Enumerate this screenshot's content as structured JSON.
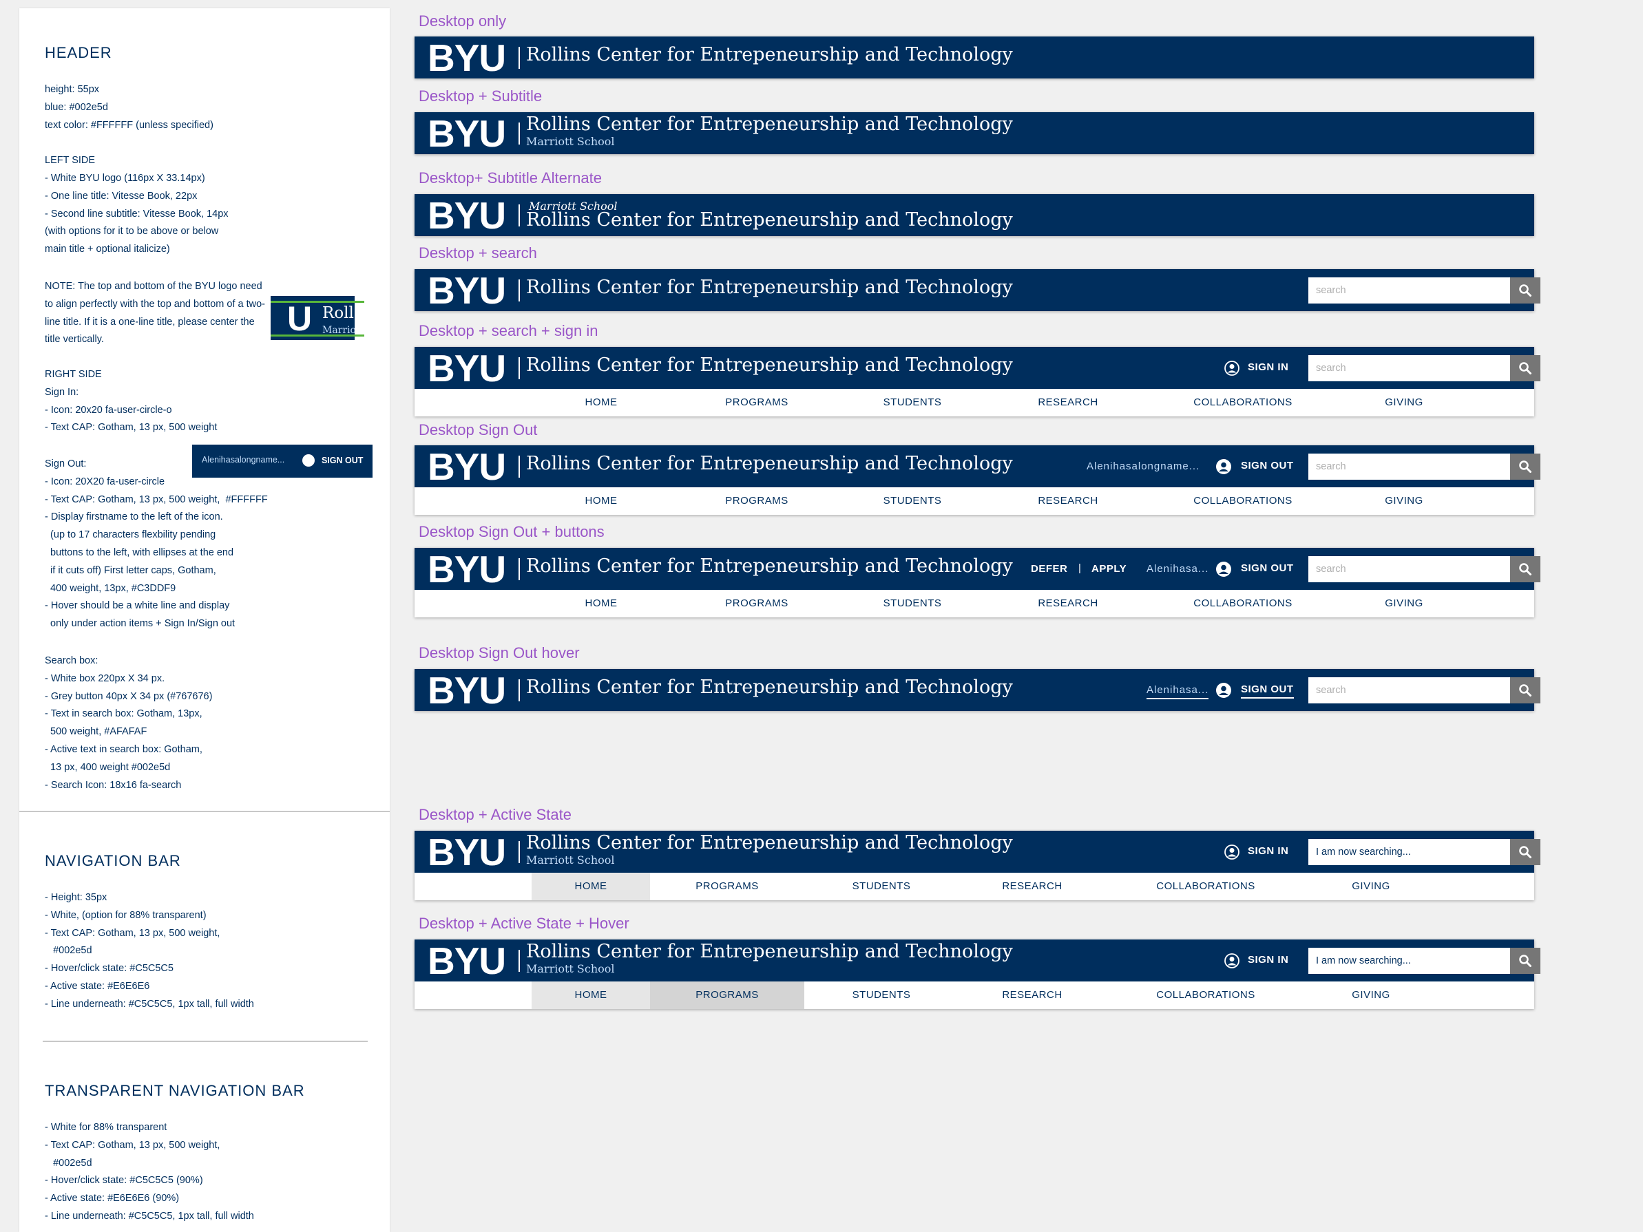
{
  "panel": {
    "header_title": "HEADER",
    "header_spec": "height: 55px\nblue: #002e5d\ntext color: #FFFFFF (unless specified)\n\nLEFT SIDE\n- White BYU logo (116px X 33.14px)\n- One line title: Vitesse Book, 22px\n- Second line subtitle: Vitesse Book, 14px\n(with options for it to be above or below\nmain title + optional italicize)",
    "note": "NOTE: The top and bottom of the BYU logo need to align perfectly with the top and bottom of a two-line title. If it is a one-line title, please center the title vertically.",
    "right_spec": "RIGHT SIDE\nSign In:\n- Icon: 20x20 fa-user-circle-o\n- Text CAP: Gotham, 13 px, 500 weight",
    "signout_spec": "Sign Out:\n- Icon: 20X20 fa-user-circle\n- Text CAP: Gotham, 13 px, 500 weight,  #FFFFFF\n- Display firstname to the left of the icon.\n  (up to 17 characters flexbility pending\n  buttons to the left, with ellipses at the end\n  if it cuts off) First letter caps, Gotham,\n  400 weight, 13px, #C3DDF9\n- Hover should be a white line and display\n  only under action items + Sign In/Sign out",
    "search_spec": "Search box:\n- White box 220px X 34 px.\n- Grey button 40px X 34 px (#767676)\n- Text in search box: Gotham, 13px,\n  500 weight, #AFAFAF\n- Active text in search box: Gotham,\n  13 px, 400 weight #002e5d\n- Search Icon: 18x16 fa-search",
    "nav_title": "NAVIGATION BAR",
    "nav_spec": "- Height: 35px\n- White, (option for 88% transparent)\n- Text CAP: Gotham, 13 px, 500 weight,\n   #002e5d\n- Hover/click state: #C5C5C5\n- Active state: #E6E6E6\n- Line underneath: #C5C5C5, 1px tall, full width",
    "tnav_title": "TRANSPARENT NAVIGATION BAR",
    "tnav_spec": "- White for 88% transparent\n- Text CAP: Gotham, 13 px, 500 weight,\n   #002e5d\n- Hover/click state: #C5C5C5 (90%)\n- Active state: #E6E6E6 (90%)\n- Line underneath: #C5C5C5, 1px tall, full width",
    "logo_sample": {
      "letter": "U",
      "title_fragment": "Roll",
      "subtitle_fragment": "Marrio"
    },
    "signout_sample": {
      "name": "Alenihasalongname...",
      "label": "SIGN OUT"
    }
  },
  "brand": {
    "logo": "BYU",
    "blue": "#002e5d",
    "name_color": "#C3DDF9",
    "search_button": "#767676",
    "label_color": "#9a56c8"
  },
  "common": {
    "title": "Rollins Center for Entrepeneurship and Technology",
    "subtitle": "Marriott School",
    "search_placeholder": "search",
    "search_active": "I am now searching...",
    "sign_in": "SIGN IN",
    "sign_out": "SIGN OUT",
    "name_long": "Alenihasalongname...",
    "name_short": "Alenihasa...",
    "defer": "DEFER",
    "pipe": "|",
    "apply": "APPLY"
  },
  "nav": [
    "HOME",
    "PROGRAMS",
    "STUDENTS",
    "RESEARCH",
    "COLLABORATIONS",
    "GIVING"
  ],
  "variants": [
    "Desktop only",
    "Desktop + Subtitle",
    "Desktop+ Subtitle Alternate",
    "Desktop + search",
    "Desktop + search + sign in",
    "Desktop Sign Out",
    "Desktop Sign Out + buttons",
    "Desktop Sign Out hover",
    "Desktop + Active State",
    "Desktop + Active State + Hover"
  ]
}
